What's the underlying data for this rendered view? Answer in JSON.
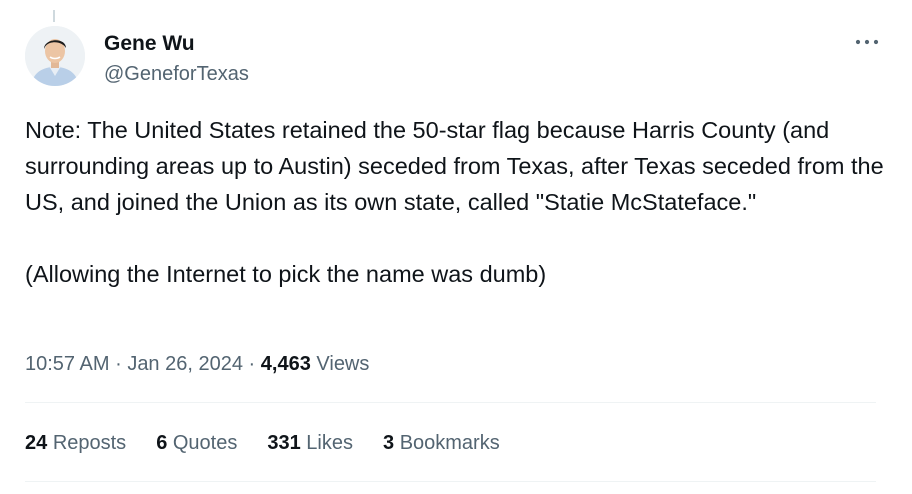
{
  "author": {
    "display_name": "Gene Wu",
    "handle": "@GeneforTexas"
  },
  "tweet": {
    "paragraphs": [
      "Note: The United States retained the 50-star flag because Harris County (and surrounding areas up to Austin) seceded from Texas, after Texas seceded from the US, and joined the Union as its own state, called \"Statie McStateface.\"",
      "(Allowing the Internet to pick the name was dumb)"
    ],
    "time": "10:57 AM",
    "date": "Jan 26, 2024",
    "separator": "·",
    "views_count": "4,463",
    "views_label": "Views"
  },
  "stats": {
    "reposts": {
      "count": "24",
      "label": "Reposts"
    },
    "quotes": {
      "count": "6",
      "label": "Quotes"
    },
    "likes": {
      "count": "331",
      "label": "Likes"
    },
    "bookmarks": {
      "count": "3",
      "label": "Bookmarks"
    }
  },
  "icons": {
    "more": "more-horizontal-icon",
    "avatar": "avatar"
  },
  "colors": {
    "text_primary": "#0f1419",
    "text_secondary": "#536471",
    "divider": "#eff3f4"
  }
}
